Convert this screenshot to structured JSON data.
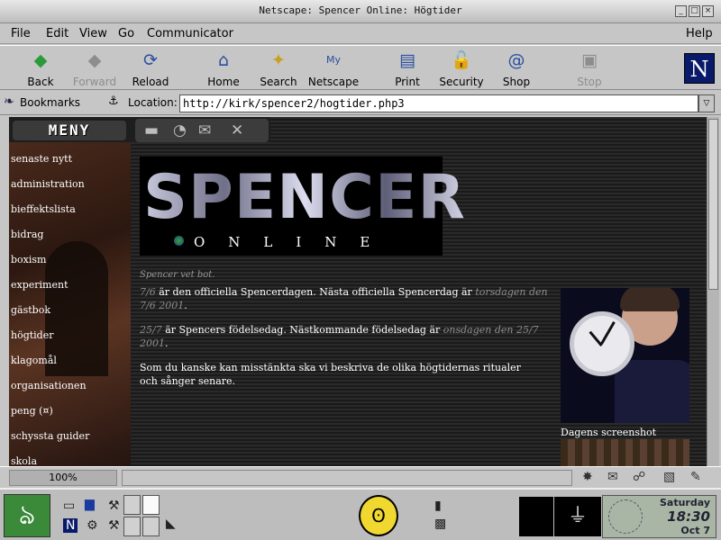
{
  "window": {
    "title": "Netscape: Spencer Online: Högtider"
  },
  "menubar": {
    "items": [
      "File",
      "Edit",
      "View",
      "Go",
      "Communicator"
    ],
    "help": "Help"
  },
  "toolbar": {
    "back": "Back",
    "forward": "Forward",
    "reload": "Reload",
    "home": "Home",
    "search": "Search",
    "netscape": "Netscape",
    "print": "Print",
    "security": "Security",
    "shop": "Shop",
    "stop": "Stop"
  },
  "location": {
    "bookmarks": "Bookmarks",
    "label": "Location:",
    "url": "http://kirk/spencer2/hogtider.php3"
  },
  "page": {
    "meny": "MENY",
    "nav": [
      "senaste nytt",
      "administration",
      "bieffektslista",
      "bidrag",
      "boxism",
      "experiment",
      "gästbok",
      "högtider",
      "klagomål",
      "organisationen",
      "peng (¤)",
      "schyssta guider",
      "skola"
    ],
    "logo_big": "SPENCER",
    "logo_online": "ONLINE",
    "vet": "Spencer vet bot.",
    "p1_a": "7/6",
    "p1_b": " är den officiella Spencerdagen. Nästa officiella Spencerdag är ",
    "p1_c": "torsdagen den 7/6 2001",
    "p1_d": ".",
    "p2_a": "25/7",
    "p2_b": " är Spencers födelsedag. Nästkommande födelsedag är ",
    "p2_c": "onsdagen den 25/7 2001",
    "p2_d": ".",
    "p3": "Som du kanske kan misstänkta ska vi beskriva de olika högtidernas ritualer och sånger senare.",
    "caption": "Dagens screenshot"
  },
  "status": {
    "zoom": "100%"
  },
  "panel": {
    "day": "Saturday",
    "time": "18:30",
    "date": "Oct 7"
  }
}
